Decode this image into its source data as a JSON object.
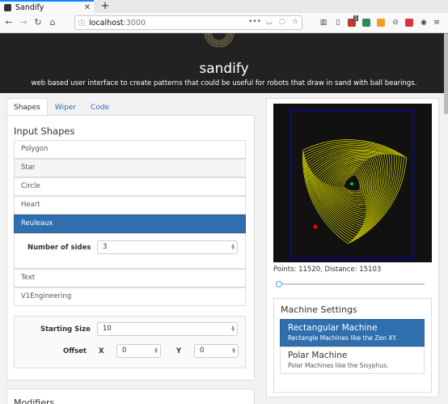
{
  "browser": {
    "tab_title": "Sandify",
    "new_tab": "+",
    "url_host": "localhost",
    "url_port": ":3000",
    "ext_badge": "1"
  },
  "app": {
    "brand": "sandify",
    "tagline": "web based user interface to create patterns that could be useful for robots that draw in sand with ball bearings."
  },
  "tabs": [
    "Shapes",
    "Wiper",
    "Code"
  ],
  "input_shapes": {
    "title": "Input Shapes",
    "items": [
      "Polygon",
      "Star",
      "Circle",
      "Heart",
      "Reuleaux",
      "Text",
      "V1Engineering"
    ],
    "selected": "Reuleaux",
    "sides_label": "Number of sides",
    "sides_value": "3"
  },
  "transform": {
    "starting_size_label": "Starting Size",
    "starting_size_value": "10",
    "offset_label": "Offset",
    "x_label": "X",
    "x_value": "0",
    "y_label": "Y",
    "y_value": "0"
  },
  "modifiers": {
    "title": "Modifiers"
  },
  "preview": {
    "stats": "Points: 11520, Distance: 15103",
    "slider_value": 0,
    "pattern_color": "#e0e000",
    "start_color": "#00cc00",
    "end_color": "#ff0000",
    "border_color": "#0000ff"
  },
  "machine": {
    "title": "Machine Settings",
    "options": [
      {
        "name": "Rectangular Machine",
        "desc": "Rectangle Machines like the Zen XY."
      },
      {
        "name": "Polar Machine",
        "desc": "Polar Machines like the Sisyphus."
      }
    ],
    "selected": "Rectangular Machine"
  }
}
